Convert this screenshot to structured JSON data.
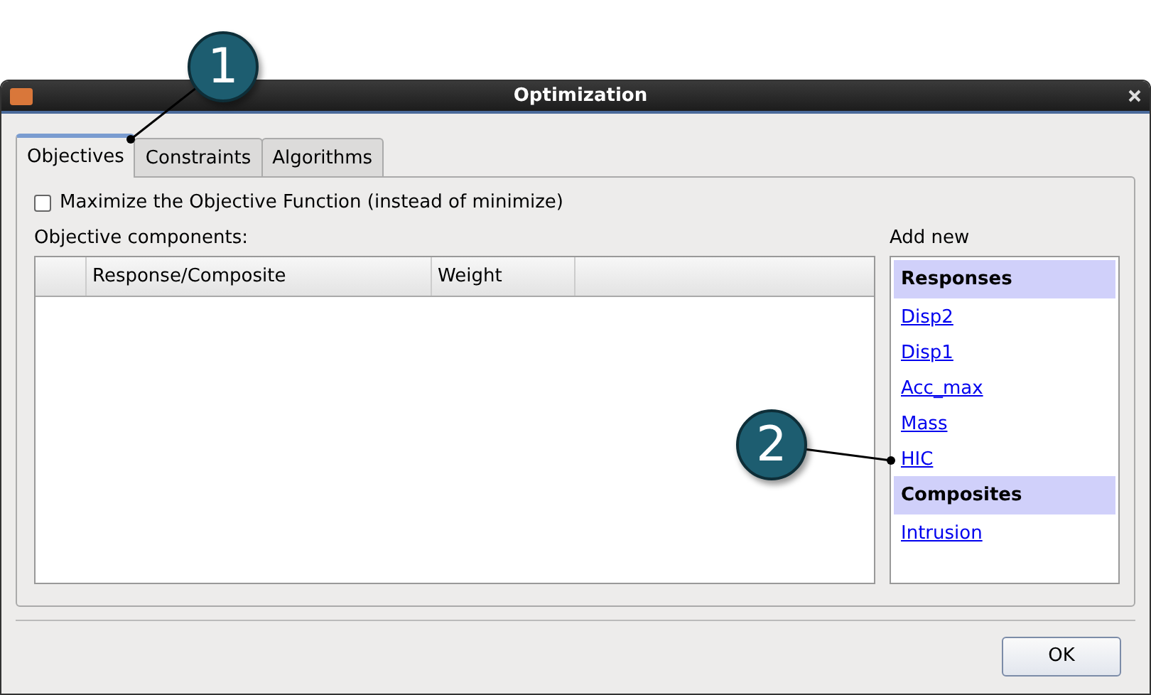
{
  "window": {
    "title": "Optimization"
  },
  "tabs": [
    {
      "label": "Objectives",
      "selected": true
    },
    {
      "label": "Constraints",
      "selected": false
    },
    {
      "label": "Algorithms",
      "selected": false
    }
  ],
  "maximize": {
    "label": "Maximize the Objective Function (instead of minimize)",
    "checked": false
  },
  "objective_components": {
    "label": "Objective components:",
    "columns": [
      "Response/Composite",
      "Weight"
    ]
  },
  "add_new": {
    "label": "Add new",
    "groups": [
      {
        "heading": "Responses",
        "items": [
          "Disp2",
          "Disp1",
          "Acc_max",
          "Mass",
          "HIC"
        ]
      },
      {
        "heading": "Composites",
        "items": [
          "Intrusion"
        ]
      }
    ]
  },
  "buttons": [
    "OK"
  ],
  "callouts": [
    "1",
    "2"
  ]
}
